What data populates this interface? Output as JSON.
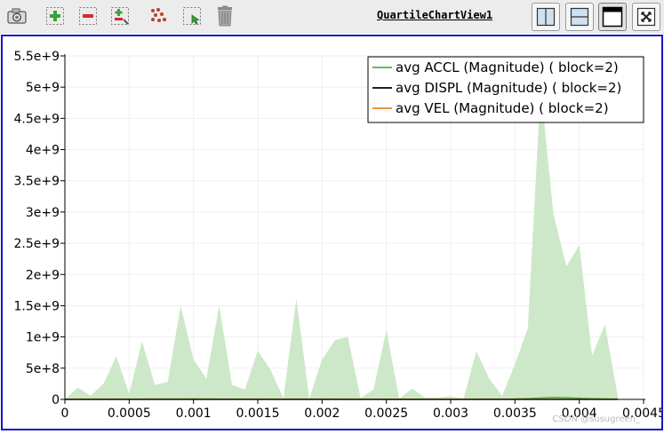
{
  "toolbar": {
    "view_title": "QuartileChartView1",
    "icons": [
      "camera-icon",
      "zoom-in-icon",
      "zoom-out-icon",
      "zoom-to-data-icon",
      "select-points-icon",
      "select-region-icon",
      "delete-icon"
    ],
    "layout_icons": [
      "split-horizontal-icon",
      "split-vertical-icon",
      "maximize-icon",
      "close-view-icon"
    ]
  },
  "chart_data": {
    "type": "area",
    "xlim": [
      0,
      0.0045
    ],
    "ylim": [
      0,
      5500000000
    ],
    "x_ticks": [
      0,
      0.0005,
      0.001,
      0.0015,
      0.002,
      0.0025,
      0.003,
      0.0035,
      0.004,
      0.0045
    ],
    "x_tick_labels": [
      "0",
      "0.0005",
      "0.001",
      "0.0015",
      "0.002",
      "0.0025",
      "0.003",
      "0.0035",
      "0.004",
      "0.0045"
    ],
    "y_ticks": [
      0,
      500000000,
      1000000000,
      1500000000,
      2000000000,
      2500000000,
      3000000000,
      3500000000,
      4000000000,
      4500000000,
      5000000000,
      5500000000
    ],
    "y_tick_labels": [
      "0",
      "5e+8",
      "1e+9",
      "1.5e+9",
      "2e+9",
      "2.5e+9",
      "3e+9",
      "3.5e+9",
      "4e+9",
      "4.5e+9",
      "5e+9",
      "5.5e+9"
    ],
    "grid": true,
    "legend_position": "top-right",
    "band": {
      "color": "#cde8c8",
      "x": [
        0,
        0.0001,
        0.0002,
        0.0003,
        0.0004,
        0.0005,
        0.0006,
        0.0007,
        0.0008,
        0.0009,
        0.001,
        0.0011,
        0.0012,
        0.0013,
        0.0014,
        0.0015,
        0.0016,
        0.0017,
        0.0018,
        0.0019,
        0.002,
        0.0021,
        0.0022,
        0.0023,
        0.0024,
        0.0025,
        0.0026,
        0.0027,
        0.0028,
        0.0029,
        0.003,
        0.0031,
        0.0032,
        0.0033,
        0.0034,
        0.0035,
        0.0036,
        0.0037,
        0.0038,
        0.0039,
        0.004,
        0.0041,
        0.0042,
        0.0043
      ],
      "upper": [
        0,
        190000000,
        60000000,
        250000000,
        690000000,
        90000000,
        930000000,
        230000000,
        280000000,
        1500000000,
        640000000,
        330000000,
        1500000000,
        230000000,
        160000000,
        780000000,
        470000000,
        20000000,
        1620000000,
        10000000,
        640000000,
        950000000,
        1000000000,
        20000000,
        160000000,
        1110000000,
        10000000,
        170000000,
        30000000,
        30000000,
        50000000,
        10000000,
        770000000,
        330000000,
        60000000,
        560000000,
        1140000000,
        5000000000,
        2960000000,
        2130000000,
        2470000000,
        700000000,
        1200000000,
        40000000
      ],
      "lower": [
        0,
        0,
        0,
        0,
        0,
        0,
        0,
        0,
        0,
        0,
        0,
        0,
        0,
        0,
        0,
        0,
        0,
        0,
        0,
        0,
        0,
        0,
        0,
        0,
        0,
        0,
        0,
        0,
        0,
        0,
        0,
        0,
        0,
        0,
        0,
        0,
        0,
        0,
        0,
        0,
        0,
        0,
        0,
        0
      ]
    },
    "series": [
      {
        "name": "avg ACCL (Magnitude) ( block=2)",
        "color": "#4daf4a",
        "x": [
          0,
          0.0005,
          0.001,
          0.0015,
          0.002,
          0.0025,
          0.003,
          0.0035,
          0.0036,
          0.0037,
          0.0038,
          0.0039,
          0.004,
          0.0041,
          0.0042,
          0.0043
        ],
        "y": [
          3000000,
          4000000,
          5000000,
          4000000,
          4000000,
          3000000,
          3000000,
          6000000,
          12000000,
          22000000,
          30000000,
          26000000,
          18000000,
          12000000,
          8000000,
          4000000
        ]
      },
      {
        "name": "avg DISPL (Magnitude) ( block=2)",
        "color": "#000000",
        "x": [
          0,
          0.0043
        ],
        "y": [
          0,
          0
        ]
      },
      {
        "name": "avg VEL (Magnitude) ( block=2)",
        "color": "#f58221",
        "x": [
          0,
          0.0043
        ],
        "y": [
          0,
          0
        ]
      }
    ]
  },
  "watermark": "CSDN @susugreen_"
}
